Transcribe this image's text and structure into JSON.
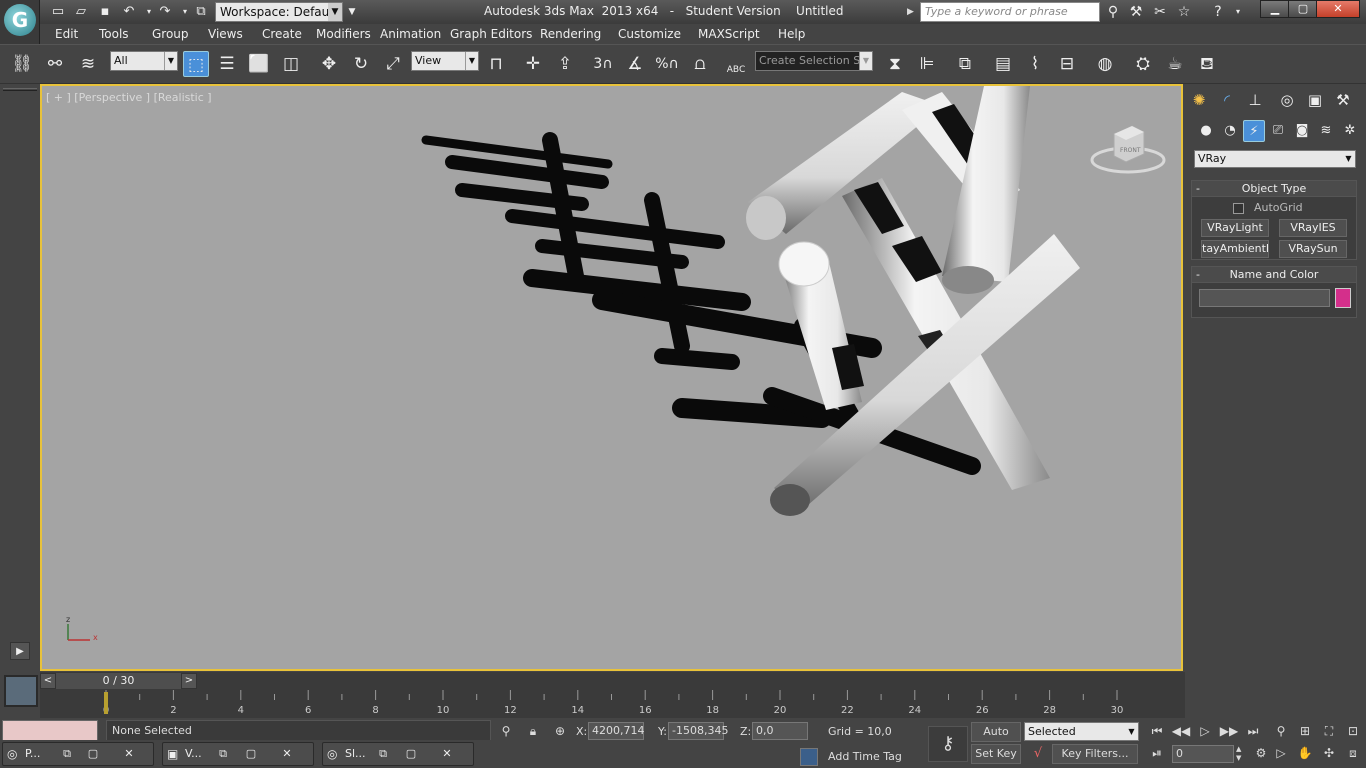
{
  "title_bar": {
    "app_name": "Autodesk 3ds Max  2013 x64",
    "edition": "Student Version",
    "document": "Untitled",
    "workspace_label": "Workspace: Default",
    "search_placeholder": "Type a keyword or phrase"
  },
  "menu": [
    "Edit",
    "Tools",
    "Group",
    "Views",
    "Create",
    "Modifiers",
    "Animation",
    "Graph Editors",
    "Rendering",
    "Customize",
    "MAXScript",
    "Help"
  ],
  "toolbar": {
    "selection_filter": "All",
    "reference_coord": "View",
    "named_selection_placeholder": "Create Selection Se",
    "snap_toggle_label": "3",
    "angle_snap_label": "%",
    "abc_label": "ABC"
  },
  "viewport": {
    "label": "[ + ] [Perspective ] [Realistic ]",
    "viewcube_label": "FRONT",
    "axis_x": "x",
    "axis_z": "z"
  },
  "command_panel": {
    "category": "VRay",
    "object_type": {
      "title": "Object Type",
      "autogrid": "AutoGrid",
      "buttons": [
        "VRayLight",
        "VRayIES",
        "tayAmbientLig",
        "VRaySun"
      ]
    },
    "name_and_color": {
      "title": "Name and Color",
      "color": "#d42f8b"
    },
    "collapse_symbol": "-"
  },
  "time_slider": {
    "frame": "0 / 30",
    "prev": "<",
    "next": ">"
  },
  "trackbar": {
    "ticks": [
      "0",
      "2",
      "4",
      "6",
      "8",
      "10",
      "12",
      "14",
      "16",
      "18",
      "20",
      "22",
      "24",
      "26",
      "28",
      "30"
    ]
  },
  "status_bar": {
    "selection": "None Selected",
    "x_label": "X:",
    "x_value": "4200,714",
    "y_label": "Y:",
    "y_value": "-1508,345",
    "z_label": "Z:",
    "z_value": "0,0",
    "grid": "Grid = 10,0",
    "add_time_tag": "Add Time Tag",
    "auto_key": "Auto Key",
    "set_key": "Set Key",
    "key_mode": "Selected",
    "key_filters": "Key Filters...",
    "current_frame": "0"
  },
  "taskbar": [
    {
      "label": "P..."
    },
    {
      "label": "V..."
    },
    {
      "label": "Sl..."
    }
  ],
  "colors": {
    "viewport_bg": "#a4a4a4",
    "viewport_border": "#e8c23a",
    "ui_bg": "#444444",
    "accent": "#4a90d9"
  }
}
